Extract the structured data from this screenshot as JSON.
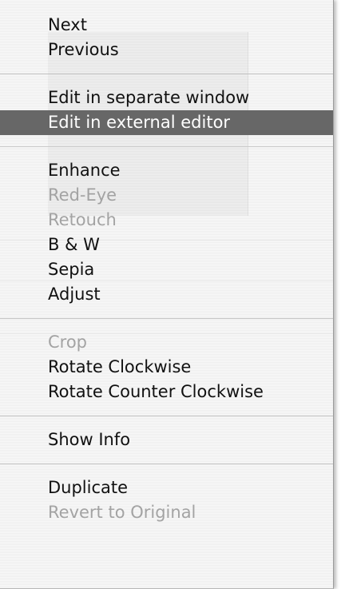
{
  "menu": {
    "groups": [
      [
        {
          "label": "Next",
          "enabled": true
        },
        {
          "label": "Previous",
          "enabled": true
        }
      ],
      [
        {
          "label": "Edit in separate window",
          "enabled": true
        },
        {
          "label": "Edit in external editor",
          "enabled": true,
          "highlighted": true
        }
      ],
      [
        {
          "label": "Enhance",
          "enabled": true
        },
        {
          "label": "Red-Eye",
          "enabled": false
        },
        {
          "label": "Retouch",
          "enabled": false
        },
        {
          "label": "B & W",
          "enabled": true
        },
        {
          "label": "Sepia",
          "enabled": true
        },
        {
          "label": "Adjust",
          "enabled": true
        }
      ],
      [
        {
          "label": "Crop",
          "enabled": false
        },
        {
          "label": "Rotate Clockwise",
          "enabled": true
        },
        {
          "label": "Rotate Counter Clockwise",
          "enabled": true
        }
      ],
      [
        {
          "label": "Show Info",
          "enabled": true
        }
      ],
      [
        {
          "label": "Duplicate",
          "enabled": true
        },
        {
          "label": "Revert to Original",
          "enabled": false
        }
      ]
    ],
    "highlight_color": "#676767",
    "disabled_color": "#a3a3a3"
  }
}
